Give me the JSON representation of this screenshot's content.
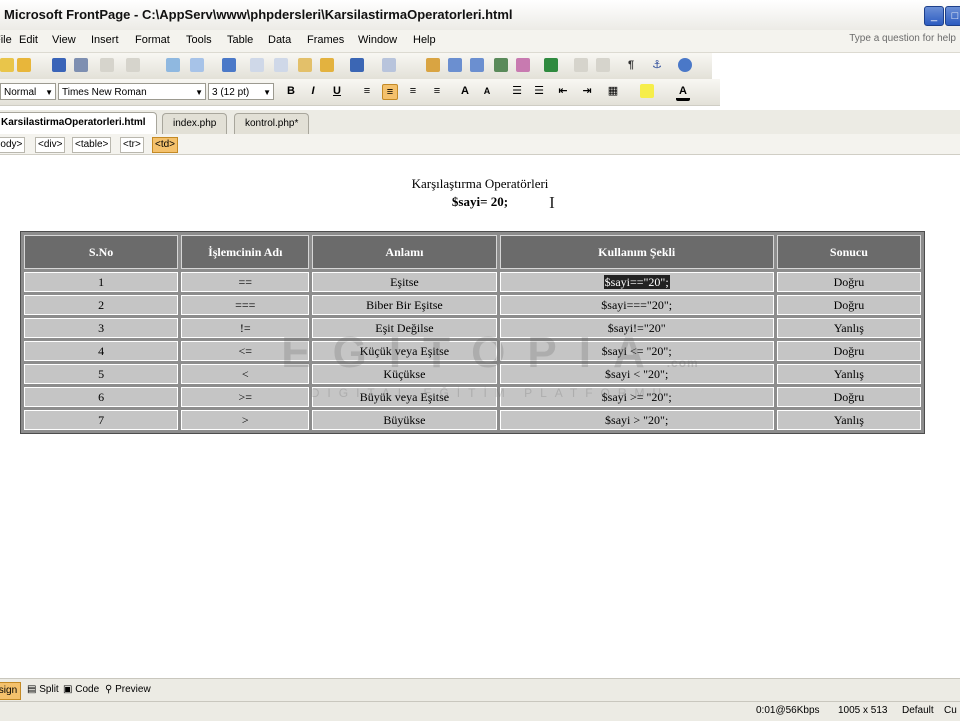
{
  "window": {
    "title": "Microsoft FrontPage - C:\\AppServ\\www\\phpdersleri\\KarsilastirmaOperatorleri.html"
  },
  "menu": [
    "File",
    "Edit",
    "View",
    "Insert",
    "Format",
    "Tools",
    "Table",
    "Data",
    "Frames",
    "Window",
    "Help"
  ],
  "help_placeholder": "Type a question for help",
  "formatting": {
    "style": "Normal",
    "font": "Times New Roman",
    "size": "3  (12 pt)",
    "bold": "B",
    "italic": "I",
    "underline": "U"
  },
  "tabs": [
    "KarsilastirmaOperatorleri.html",
    "index.php",
    "kontrol.php*"
  ],
  "quick_tags": [
    "<body>",
    "<div>",
    "<table>",
    "<tr>",
    "<td>"
  ],
  "page": {
    "heading": "Karşılaştırma Operatörleri",
    "var_line": "$sayi= 20;"
  },
  "table": {
    "headers": [
      "S.No",
      "İşlemcinin Adı",
      "Anlamı",
      "Kullanım Şekli",
      "Sonucu"
    ],
    "rows": [
      [
        "1",
        "==",
        "Eşitse",
        "$sayi==\"20\";",
        "Doğru"
      ],
      [
        "2",
        "===",
        "Biber Bir Eşitse",
        "$sayi===\"20\";",
        "Doğru"
      ],
      [
        "3",
        "!=",
        "Eşit Değilse",
        "$sayi!=\"20\"",
        "Yanlış"
      ],
      [
        "4",
        "<=",
        "Küçük veya Eşitse",
        "$sayi <= \"20\";",
        "Doğru"
      ],
      [
        "5",
        "<",
        "Küçükse",
        "$sayi < \"20\";",
        "Yanlış"
      ],
      [
        "6",
        ">=",
        "Büyük veya Eşitse",
        "$sayi >= \"20\";",
        "Doğru"
      ],
      [
        "7",
        ">",
        "Büyükse",
        "$sayi > \"20\";",
        "Yanlış"
      ]
    ]
  },
  "watermark": {
    "main": "EGITOPIA",
    "sub": "DIGITAL EĞİTİM PLATFORMU",
    "com": ".com"
  },
  "views": [
    "Design",
    "Split",
    "Code",
    "Preview"
  ],
  "status": {
    "speed": "0:01@56Kbps",
    "size": "1005 x 513",
    "mode": "Default",
    "extra": "Cu"
  }
}
